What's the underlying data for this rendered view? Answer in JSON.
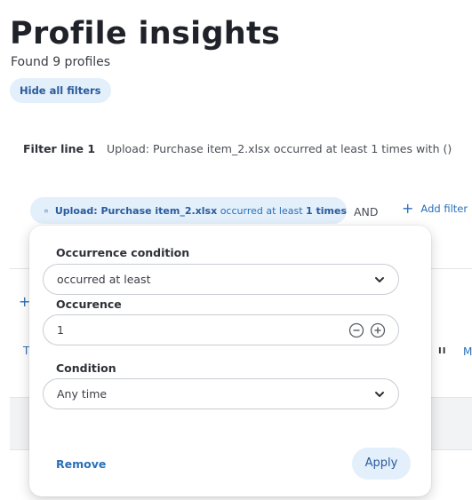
{
  "page": {
    "title": "Profile insights",
    "profile_count": "Found 9 profiles",
    "hide_filters_label": "Hide all filters"
  },
  "filter_line": {
    "title": "Filter line 1",
    "summary": "Upload: Purchase item_2.xlsx occurred at least 1 times with ()"
  },
  "filter_chip": {
    "event": "Upload: Purchase item_2.xlsx",
    "mid": " occurred at least ",
    "count": "1 times"
  },
  "connector": "AND",
  "add_filter_label": "Add filter",
  "background": {
    "t_fragment": "T",
    "m_fragment": "M"
  },
  "popover": {
    "occurrence_condition_label": "Occurrence condition",
    "occurrence_condition_value": "occurred at least",
    "occurence_label": "Occurence",
    "occurence_value": "1",
    "condition_label": "Condition",
    "condition_value": "Any time",
    "remove_label": "Remove",
    "apply_label": "Apply"
  },
  "colors": {
    "accent": "#2a6fb8",
    "chip_bg": "#e3effb"
  }
}
